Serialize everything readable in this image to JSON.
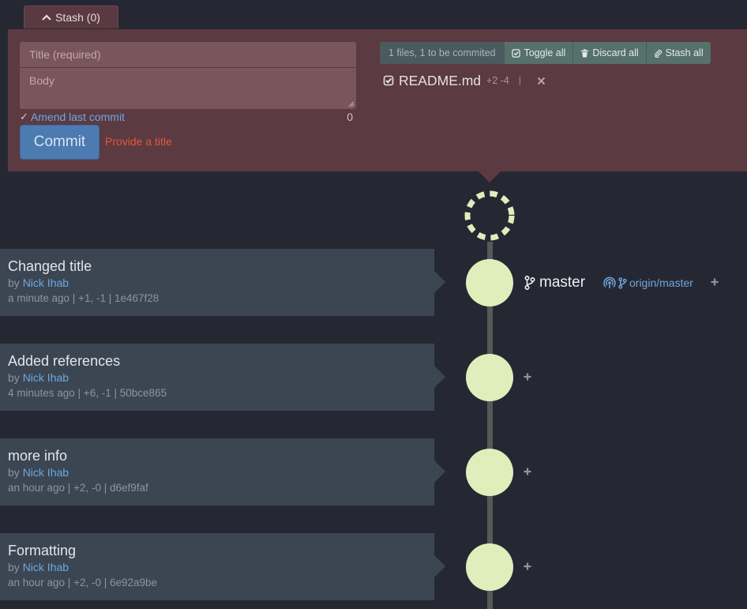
{
  "stash": {
    "label": "Stash (0)"
  },
  "commit_form": {
    "title_placeholder": "Title (required)",
    "body_placeholder": "Body",
    "amend_label": "Amend last commit",
    "char_count": "0",
    "commit_label": "Commit",
    "hint": "Provide a title"
  },
  "staging": {
    "summary": "1 files, 1 to be commited",
    "toggle_all": "Toggle all",
    "discard_all": "Discard all",
    "stash_all": "Stash all",
    "files": [
      {
        "name": "README.md",
        "stats": "+2 -4",
        "separator": "|"
      }
    ]
  },
  "commits": [
    {
      "title": "Changed title",
      "by": "by",
      "author": "Nick Ihab",
      "meta": "a minute ago | +1, -1 | 1e467f28"
    },
    {
      "title": "Added references",
      "by": "by",
      "author": "Nick Ihab",
      "meta": "4 minutes ago | +6, -1 | 50bce865"
    },
    {
      "title": "more info",
      "by": "by",
      "author": "Nick Ihab",
      "meta": "an hour ago | +2, -0 | d6ef9faf"
    },
    {
      "title": "Formatting",
      "by": "by",
      "author": "Nick Ihab",
      "meta": "an hour ago | +2, -0 | 6e92a9be"
    }
  ],
  "refs": {
    "local_branch": "master",
    "remote_branch": "origin/master"
  },
  "colors": {
    "background": "#252833",
    "panel": "#5c3a42",
    "node": "#e0eebc",
    "link": "#6fa7dd",
    "warning": "#e0573c"
  }
}
